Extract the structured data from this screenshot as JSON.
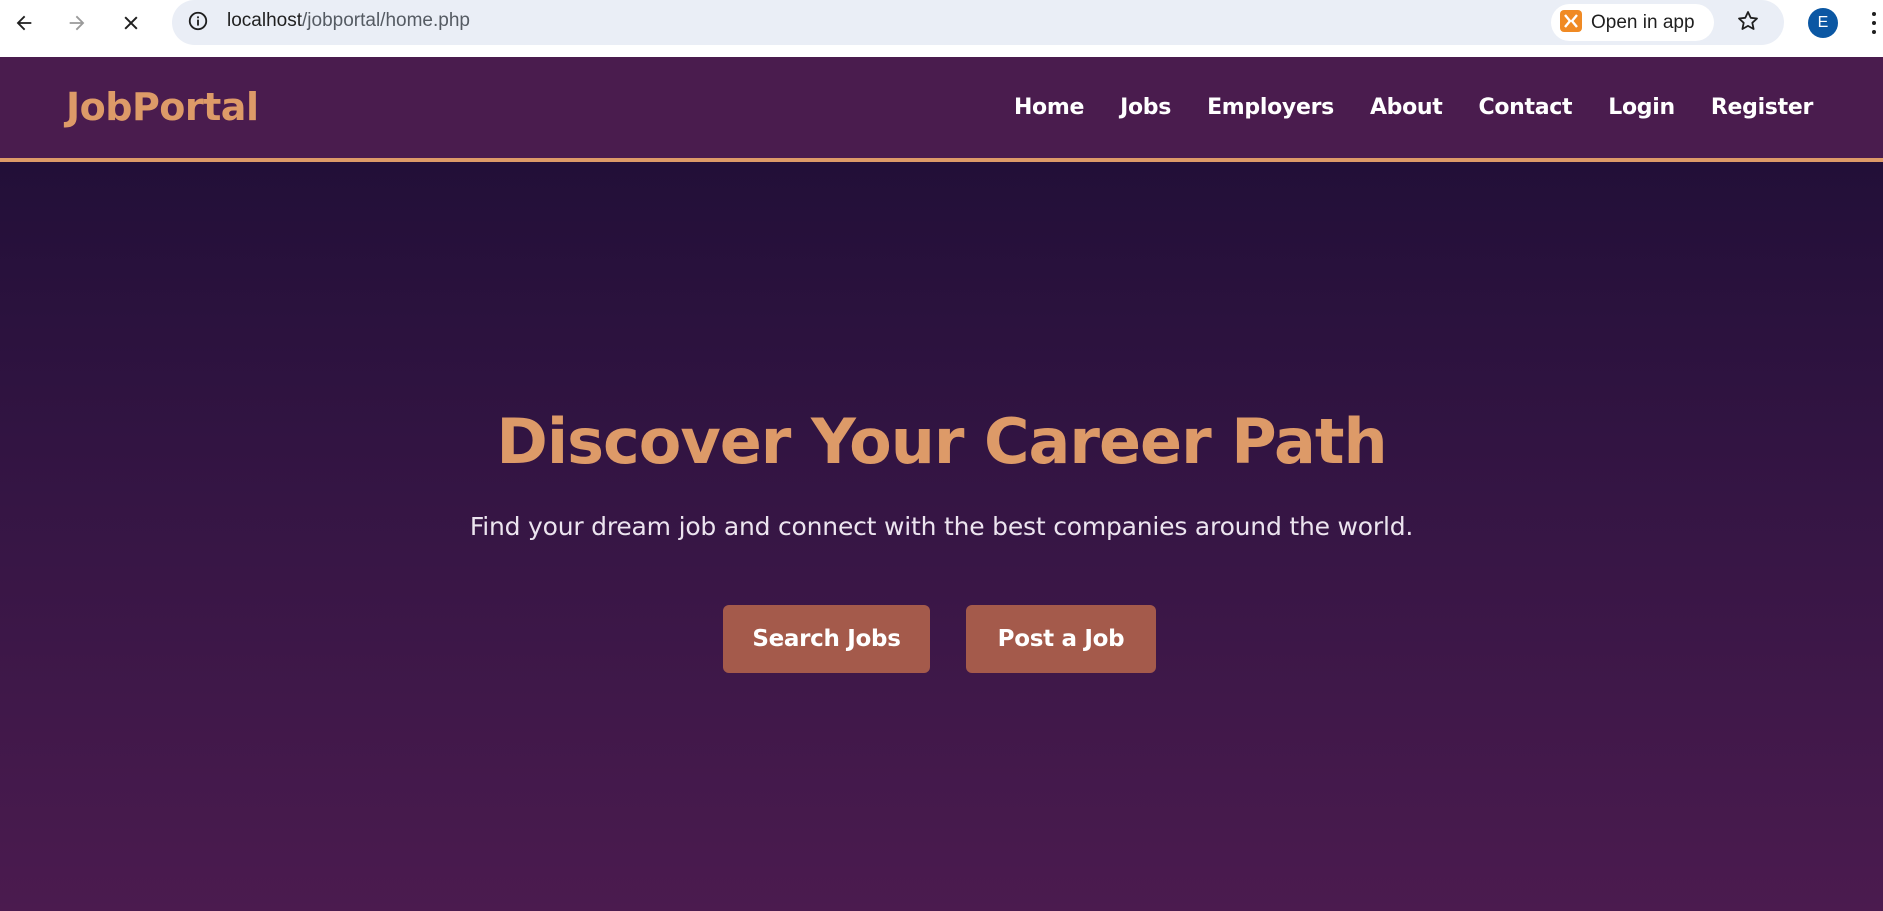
{
  "browser": {
    "url_host": "localhost",
    "url_path": "/jobportal/home.php",
    "open_in_app_label": "Open in app",
    "profile_initial": "E",
    "icons": {
      "back": "arrow-left-icon",
      "forward": "arrow-right-icon",
      "stop": "close-icon",
      "site_info": "info-icon",
      "app": "xampp-app-icon",
      "bookmark": "star-icon",
      "menu": "more-vertical-icon"
    }
  },
  "header": {
    "logo": "JobPortal",
    "nav": [
      {
        "label": "Home"
      },
      {
        "label": "Jobs"
      },
      {
        "label": "Employers"
      },
      {
        "label": "About"
      },
      {
        "label": "Contact"
      },
      {
        "label": "Login"
      },
      {
        "label": "Register"
      }
    ]
  },
  "hero": {
    "title": "Discover Your Career Path",
    "subtitle": "Find your dream job and connect with the best companies around the world.",
    "buttons": {
      "primary": "Search Jobs",
      "secondary": "Post a Job"
    }
  },
  "colors": {
    "header_bg": "#4a1c4e",
    "accent": "#dd9a68",
    "hero_top": "#220f38",
    "hero_bottom": "#4b1b4f",
    "button_bg": "#a45a4b",
    "avatar_bg": "#0b57a3"
  }
}
